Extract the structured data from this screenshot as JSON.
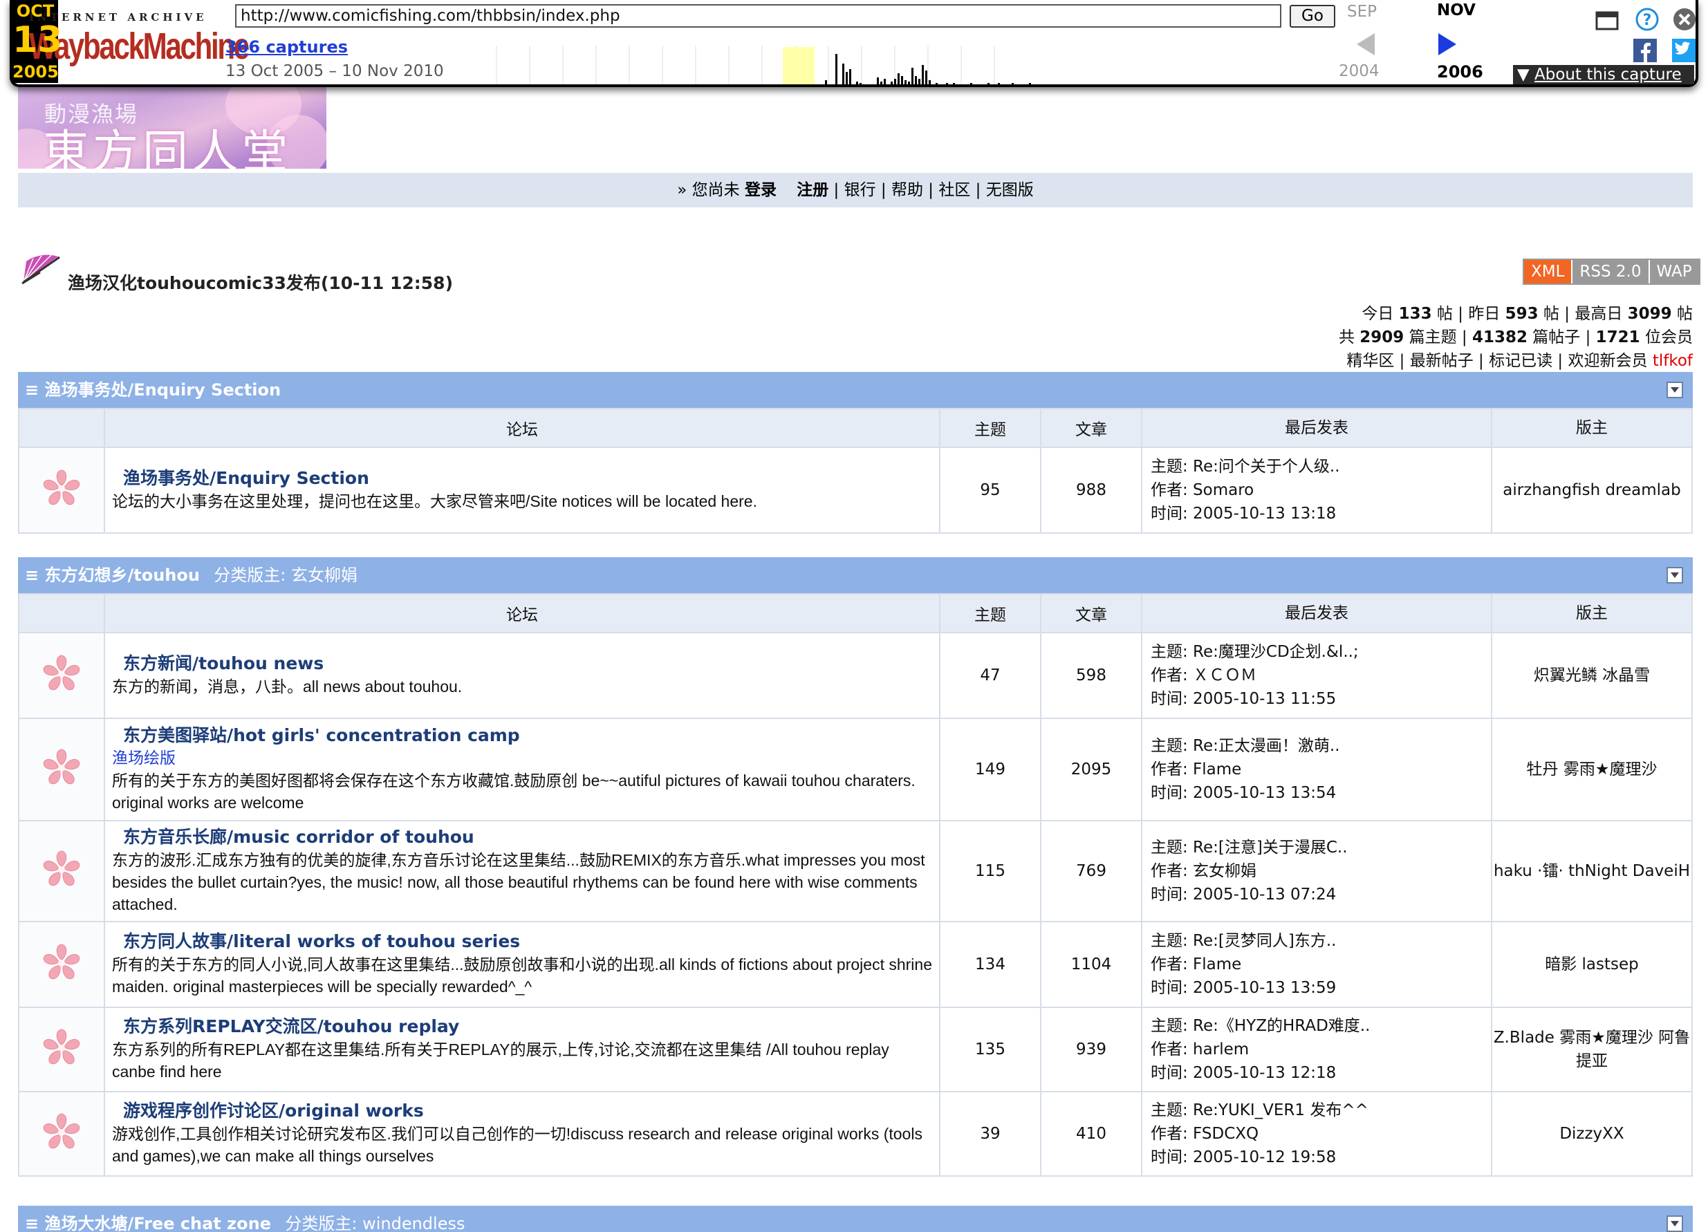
{
  "wayback": {
    "logo_top": "INTERNET ARCHIVE",
    "logo_bottom": "WaybackMachine",
    "url": "http://www.comicfishing.com/thbbsin/index.php",
    "go_label": "Go",
    "captures": "366 captures",
    "range": "13 Oct 2005 – 10 Nov 2010",
    "prev_month": "SEP",
    "cur_month": "OCT",
    "next_month": "NOV",
    "day": "13",
    "prev_year": "2004",
    "cur_year": "2005",
    "next_year": "2006",
    "about": "About this capture"
  },
  "banner": {
    "sub": "動漫漁場",
    "main": "東方同人堂"
  },
  "nav": {
    "prefix": "» 您尚未",
    "login": "登录",
    "register": "注册",
    "sep": "|",
    "bank": "银行",
    "help": "帮助",
    "community": "社区",
    "noimage": "无图版"
  },
  "announcement": "渔场汉化touhoucomic33发布(10-11 12:58)",
  "feeds": {
    "xml": "XML",
    "rss": "RSS 2.0",
    "wap": "WAP"
  },
  "stats": {
    "today_label": "今日",
    "today": "133",
    "post_unit": "帖",
    "yesterday_label": "昨日",
    "yesterday": "593",
    "max_label": "最高日",
    "max": "3099",
    "total_label": "共",
    "topics": "2909",
    "topics_unit": "篇主题",
    "posts": "41382",
    "posts_unit": "篇帖子",
    "members": "1721",
    "members_unit": "位会员",
    "digest": "精华区",
    "newposts": "最新帖子",
    "markread": "标记已读",
    "welcome": "欢迎新会员",
    "newmember": "tlfkof"
  },
  "columns": {
    "forum": "论坛",
    "topics": "主题",
    "posts": "文章",
    "last": "最后发表",
    "mods": "版主"
  },
  "categories": [
    {
      "title": "≡ 渔场事务处/Enquiry Section",
      "mod_label": "",
      "mod_name": "",
      "forums": [
        {
          "name": "渔场事务处/Enquiry Section",
          "sub": "",
          "desc": "论坛的大小事务在这里处理，提问也在这里。大家尽管来吧/Site notices will be located here.",
          "topics": "95",
          "posts": "988",
          "last_topic": "主题: Re:问个关于个人级..",
          "last_author": "作者: Somaro",
          "last_time": "时间: 2005-10-13 13:18",
          "mods": "airzhangfish dreamlab"
        }
      ]
    },
    {
      "title": "≡ 东方幻想乡/touhou",
      "mod_label": "分类版主: ",
      "mod_name": "玄女柳娟",
      "forums": [
        {
          "name": "东方新闻/touhou news",
          "sub": "",
          "desc": "东方的新闻，消息，八卦。all news about touhou.",
          "topics": "47",
          "posts": "598",
          "last_topic": "主题: Re:魔理沙CD企划.&l..;",
          "last_author": "作者: ＸＣＯＭ",
          "last_time": "时间: 2005-10-13 11:55",
          "mods": "炽翼光鳞 冰晶雪"
        },
        {
          "name": "东方美图驿站/hot girls' concentration camp",
          "sub": "渔场绘版",
          "desc": "所有的关于东方的美图好图都将会保存在这个东方收藏馆.鼓励原创 be~~autiful pictures of kawaii touhou charaters. original works are welcome",
          "topics": "149",
          "posts": "2095",
          "last_topic": "主题: Re:正太漫画！激萌..",
          "last_author": "作者: Flame",
          "last_time": "时间: 2005-10-13 13:54",
          "mods": "牡丹 雾雨★魔理沙"
        },
        {
          "name": "东方音乐长廊/music corridor of touhou",
          "sub": "",
          "desc": "东方的波形.汇成东方独有的优美的旋律,东方音乐讨论在这里集结...鼓励REMIX的东方音乐.what impresses you most besides the bullet curtain?yes, the music! now, all those beautiful rhythems can be found here with wise comments attached.",
          "topics": "115",
          "posts": "769",
          "last_topic": "主题: Re:[注意]关于漫展C..",
          "last_author": "作者: 玄女柳娟",
          "last_time": "时间: 2005-10-13 07:24",
          "mods": "haku ·镭· thNight DaveiH"
        },
        {
          "name": "东方同人故事/literal works of touhou series",
          "sub": "",
          "desc": "所有的关于东方的同人小说,同人故事在这里集结...鼓励原创故事和小说的出现.all kinds of fictions about project shrine maiden. original masterpieces will be specially rewarded^_^",
          "topics": "134",
          "posts": "1104",
          "last_topic": "主题: Re:[灵梦同人]东方..",
          "last_author": "作者: Flame",
          "last_time": "时间: 2005-10-13 13:59",
          "mods": "暗影 lastsep"
        },
        {
          "name": "东方系列REPLAY交流区/touhou replay",
          "sub": "",
          "desc": "东方系列的所有REPLAY都在这里集结.所有关于REPLAY的展示,上传,讨论,交流都在这里集结 /All touhou replay canbe find here",
          "topics": "135",
          "posts": "939",
          "last_topic": "主题: Re:《HYZ的HRAD难度..",
          "last_author": "作者: harlem",
          "last_time": "时间: 2005-10-13 12:18",
          "mods": "Z.Blade 雾雨★魔理沙 阿鲁提亚"
        },
        {
          "name": "游戏程序创作讨论区/original works",
          "sub": "",
          "desc": "游戏创作,工具创作相关讨论研究发布区.我们可以自己创作的一切!discuss research and release original works (tools and games),we can make all things ourselves",
          "topics": "39",
          "posts": "410",
          "last_topic": "主题: Re:YUKI_VER1 发布^^",
          "last_author": "作者: FSDCXQ",
          "last_time": "时间: 2005-10-12 19:58",
          "mods": "DizzyXX"
        }
      ]
    },
    {
      "title": "≡ 渔场大水塘/Free chat zone",
      "mod_label": "分类版主: ",
      "mod_name": "windendless",
      "forums": []
    }
  ],
  "colors": {
    "cat_header": "#8eb1e6",
    "nav_bg": "#dde4ef",
    "forum_link": "#1c3d78",
    "xml_badge": "#f26522"
  }
}
